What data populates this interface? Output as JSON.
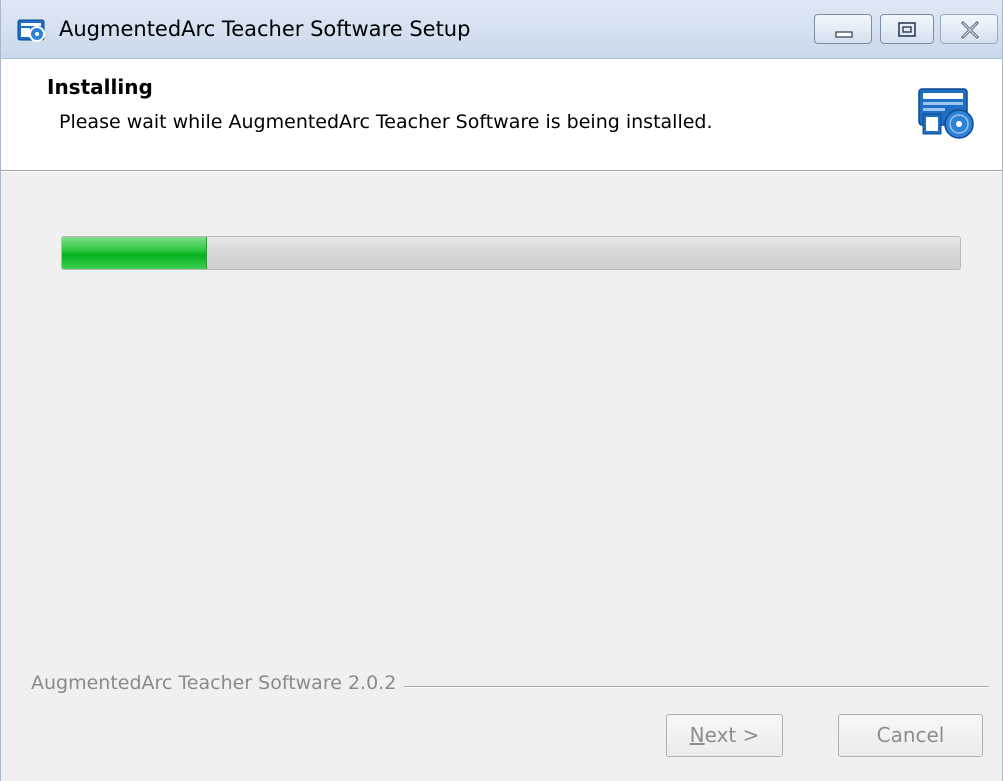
{
  "window": {
    "title": "AugmentedArc Teacher Software Setup",
    "icon": "installer-icon",
    "controls": [
      "minimize-icon",
      "maximize-icon",
      "close-icon"
    ]
  },
  "header": {
    "title": "Installing",
    "subtitle": "Please wait while AugmentedArc Teacher Software is being installed.",
    "icon": "setup-computer-icon"
  },
  "progress": {
    "fraction": 0.16,
    "fill_color": "#1ec032"
  },
  "footer": {
    "brand_text": "AugmentedArc Teacher Software 2.0.2",
    "next_label": "Next >",
    "cancel_label": "Cancel"
  }
}
